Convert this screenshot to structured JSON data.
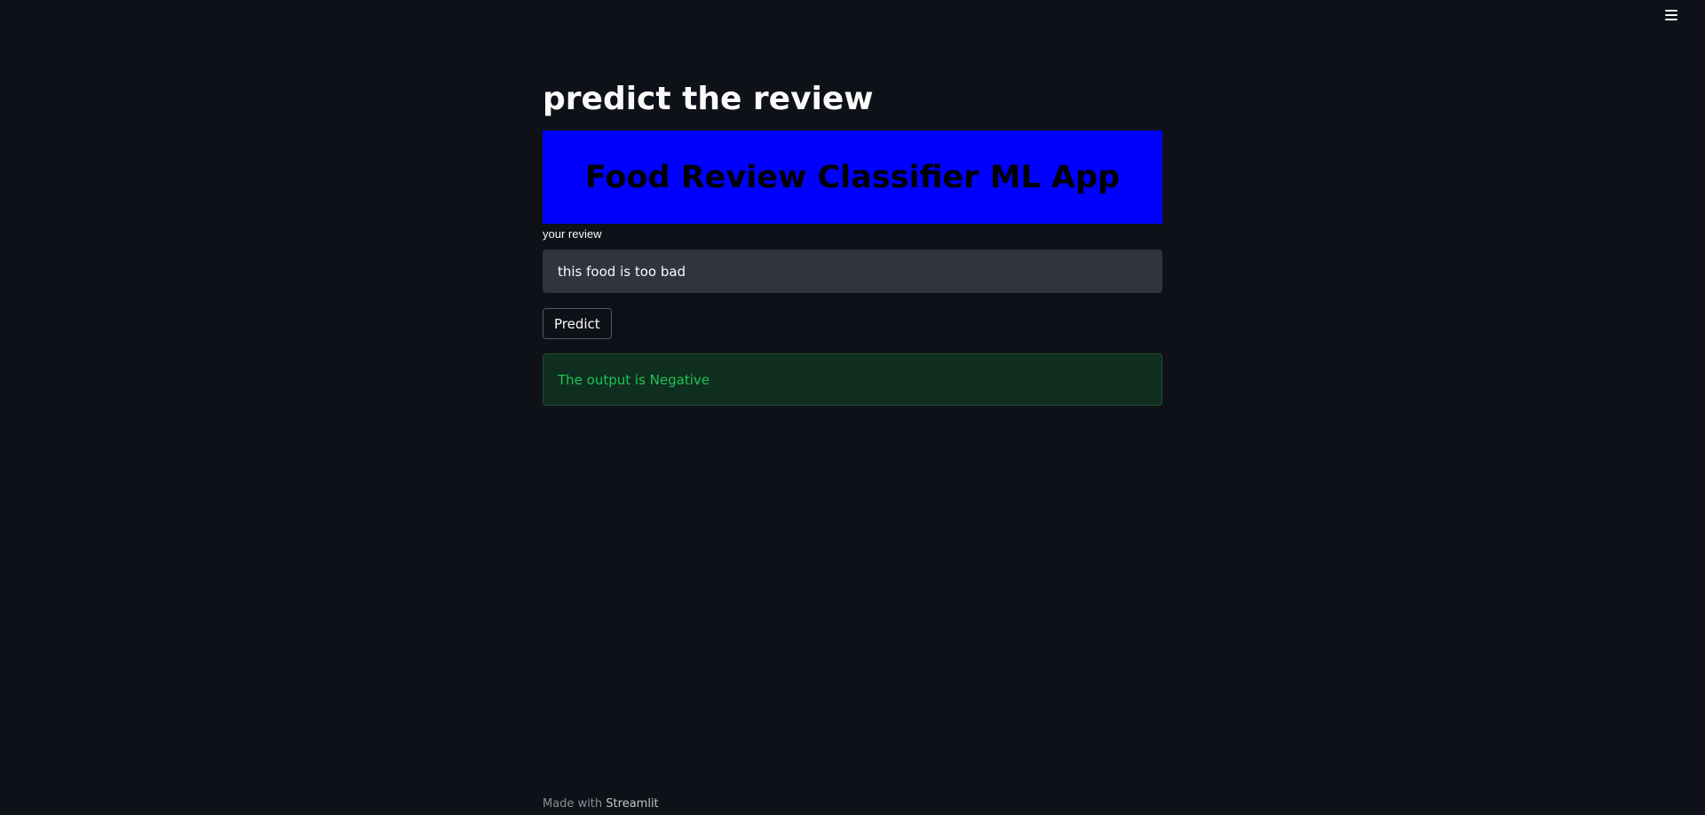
{
  "header": {
    "menu_icon": "hamburger-menu-icon"
  },
  "main": {
    "title": "predict the review",
    "banner": {
      "title": "Food Review Classifier ML App",
      "background_color": "#0000ff",
      "text_color": "#000000"
    },
    "review_input": {
      "label": "your review",
      "value": "this food is too bad"
    },
    "predict_button": {
      "label": "Predict"
    },
    "result": {
      "text": "The output is Negative",
      "status_color": "#21c354"
    }
  },
  "footer": {
    "prefix": "Made with",
    "link": "Streamlit"
  }
}
